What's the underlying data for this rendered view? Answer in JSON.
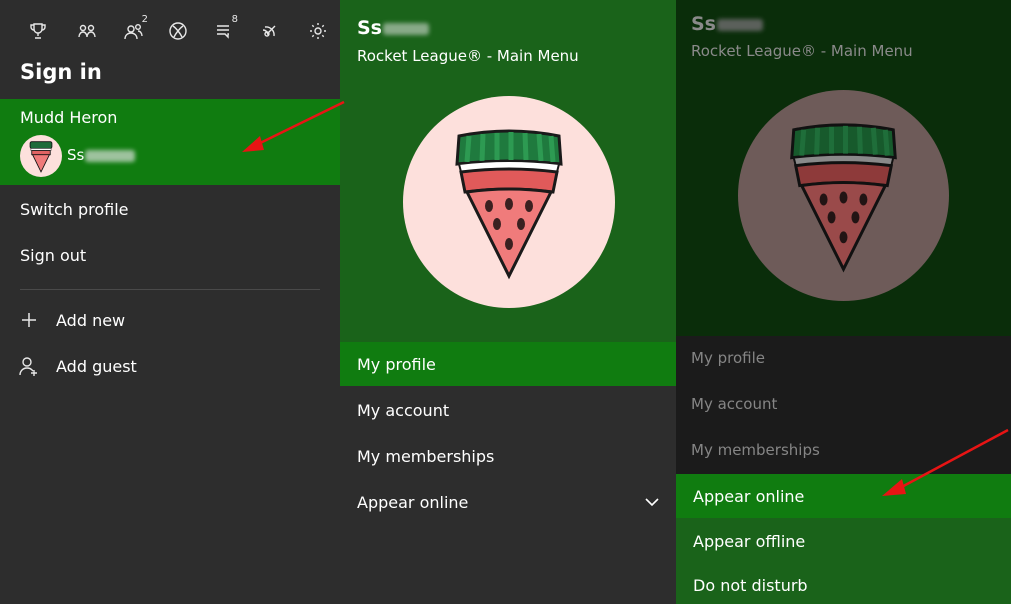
{
  "colors": {
    "accent_green": "#107c10",
    "hero_green": "#1a631a",
    "dark_green": "#0a2d0a",
    "panel_bg": "#2d2d2d",
    "dim_bg": "#1b1b1b",
    "annotation_red": "#e81414"
  },
  "guide_panel": {
    "top_icons": [
      {
        "name": "achievements-trophy-icon",
        "badge": ""
      },
      {
        "name": "friends-icon",
        "badge": ""
      },
      {
        "name": "party-icon",
        "badge": "2"
      },
      {
        "name": "xbox-home-icon",
        "badge": ""
      },
      {
        "name": "messages-icon",
        "badge": "8"
      },
      {
        "name": "broadcast-icon",
        "badge": ""
      },
      {
        "name": "settings-gear-icon",
        "badge": ""
      }
    ],
    "heading": "Sign in",
    "selected_profile": {
      "name": "Mudd Heron",
      "gamertag_visible": "Ss"
    },
    "items": [
      "Switch profile",
      "Sign out"
    ],
    "actions": [
      "Add new",
      "Add guest"
    ]
  },
  "profile_panel": {
    "gamertag_visible": "Ss",
    "status": "Rocket League® - Main Menu",
    "menu": [
      "My profile",
      "My account",
      "My memberships",
      "Appear online"
    ],
    "active_index": 0,
    "dropdown_icon": "chevron-down-icon"
  },
  "presence_panel": {
    "gamertag_visible": "Ss",
    "status": "Rocket League® - Main Menu",
    "menu": [
      "My profile",
      "My account",
      "My memberships"
    ],
    "options": [
      "Appear online",
      "Appear offline",
      "Do not disturb"
    ],
    "active_option_index": 0
  },
  "annotations": [
    {
      "name": "red-arrow-to-selected-profile"
    },
    {
      "name": "red-arrow-to-appear-online"
    }
  ]
}
